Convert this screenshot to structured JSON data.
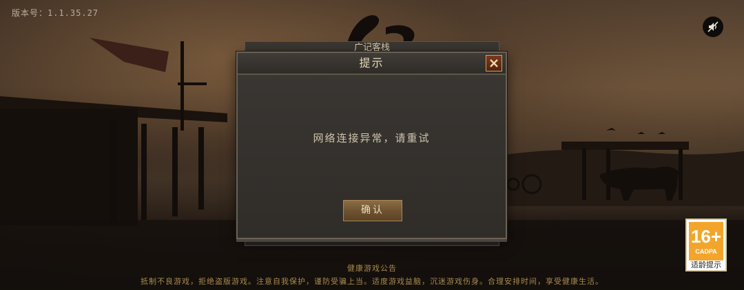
{
  "version": "版本号：1.1.35.27",
  "back_panel": {
    "title": "广记客栈"
  },
  "dialog": {
    "title": "提示",
    "message": "网络连接异常，请重试",
    "confirm_label": "确认"
  },
  "notice": {
    "title": "健康游戏公告",
    "text": "抵制不良游戏，拒绝盗版游戏。注意自我保护，谨防受骗上当。适度游戏益脑，沉迷游戏伤身。合理安排时间，享受健康生活。"
  },
  "age_rating": {
    "age": "16+",
    "org": "CADPA",
    "label": "适龄提示",
    "color": "#f3a52b"
  },
  "icons": {
    "mute": "sound-muted-icon",
    "close": "close-icon"
  }
}
